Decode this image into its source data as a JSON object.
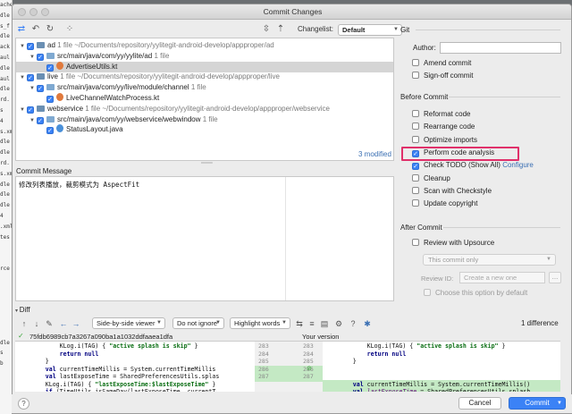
{
  "background_editor_lines": [
    "ache",
    "dle",
    "s_f",
    "dle",
    "ack",
    "aul",
    "dle",
    "aul",
    "dle",
    "rd.",
    "s",
    "4",
    "s.xm",
    "dle",
    "dle",
    "rd.",
    "s.xm",
    "dle",
    "dle",
    "dle",
    "4",
    ".xml",
    "tes",
    "",
    "",
    "rce",
    "",
    "",
    "",
    "",
    "",
    "",
    "dle",
    "s",
    "b",
    ""
  ],
  "window": {
    "title": "Commit Changes"
  },
  "toolbar": {
    "changelist_label": "Changelist:",
    "changelist_value": "Default"
  },
  "tree": {
    "rows": [
      {
        "label": "ad",
        "meta": "1 file  ~/Documents/repository/yylitegit-android-develop/appproper/ad",
        "type": "folder"
      },
      {
        "label": "src/main/java/com/yy/yylite/ad",
        "meta": "1 file",
        "type": "folder"
      },
      {
        "label": "AdvertiseUtils.kt",
        "meta": "",
        "type": "file"
      },
      {
        "label": "live",
        "meta": "1 file  ~/Documents/repository/yylitegit-android-develop/appproper/live",
        "type": "folder"
      },
      {
        "label": "src/main/java/com/yy/live/module/channel",
        "meta": "1 file",
        "type": "folder"
      },
      {
        "label": "LiveChannelWatchProcess.kt",
        "meta": "",
        "type": "file"
      },
      {
        "label": "webservice",
        "meta": "1 file  ~/Documents/repository/yylitegit-android-develop/appproper/webservice",
        "type": "folder"
      },
      {
        "label": "src/main/java/com/yy/webservice/webwindow",
        "meta": "1 file",
        "type": "folder"
      },
      {
        "label": "StatusLayout.java",
        "meta": "",
        "type": "file"
      }
    ],
    "modified_count": "3 modified"
  },
  "commit_message": {
    "label": "Commit Message",
    "text": "修改列表播放，裁剪模式为 AspectFit"
  },
  "git": {
    "section": "Git",
    "author_label": "Author:",
    "author_value": "",
    "amend": "Amend commit",
    "signoff": "Sign-off commit"
  },
  "before_commit": {
    "section": "Before Commit",
    "options": [
      {
        "label": "Reformat code",
        "checked": false
      },
      {
        "label": "Rearrange code",
        "checked": false
      },
      {
        "label": "Optimize imports",
        "checked": false
      },
      {
        "label": "Perform code analysis",
        "checked": true
      },
      {
        "label": "Check TODO (Show All)",
        "checked": true,
        "link": "Configure"
      },
      {
        "label": "Cleanup",
        "checked": false
      },
      {
        "label": "Scan with Checkstyle",
        "checked": false
      },
      {
        "label": "Update copyright",
        "checked": false
      }
    ]
  },
  "after_commit": {
    "section": "After Commit",
    "review_upsource": "Review with Upsource",
    "commit_only": "This commit only",
    "review_id_label": "Review ID:",
    "review_id_placeholder": "Create a new one",
    "dots": "...",
    "choose_default": "Choose this option by default"
  },
  "diff": {
    "header": "Diff",
    "viewer": "Side-by-side viewer",
    "ignore": "Do not ignore",
    "highlight": "Highlight words",
    "differences": "1 difference",
    "left_hash": "75fdb6989cb7a3267a090ba1a1032ddfaaea1dfa",
    "right_title": "Your version",
    "left_lines": [
      {
        "num": "283",
        "parts": [
          [
            "",
            "            KLog.i(TAG) { "
          ],
          [
            "s",
            "\"active splash is skip\""
          ],
          [
            "",
            " }"
          ]
        ]
      },
      {
        "num": "284",
        "parts": [
          [
            "",
            "            "
          ],
          [
            "k",
            "return null"
          ]
        ]
      },
      {
        "num": "285",
        "parts": [
          [
            "",
            "        }"
          ]
        ]
      },
      {
        "num": "286",
        "parts": [
          [
            "",
            "        "
          ],
          [
            "k",
            "val"
          ],
          [
            "",
            " currentTimeMillis = System.currentTimeMillis"
          ]
        ]
      },
      {
        "num": "287",
        "parts": [
          [
            "",
            "        "
          ],
          [
            "k",
            "val"
          ],
          [
            "",
            " lastExposeTime = SharedPreferencesUtils.splas"
          ]
        ]
      },
      {
        "num": "",
        "parts": [
          [
            "",
            "        KLog.i(TAG) { "
          ],
          [
            "s",
            "\"lastExposeTime:$lastExposeTime\""
          ],
          [
            "",
            " }"
          ]
        ]
      },
      {
        "num": "",
        "parts": [
          [
            "",
            "        "
          ],
          [
            "k",
            "if"
          ],
          [
            "",
            " (TimeUtils.isSameDay(lastExposeTime, currentT"
          ]
        ]
      }
    ],
    "right_lines": [
      {
        "num": "283",
        "parts": [
          [
            "",
            "            KLog.i(TAG) { "
          ],
          [
            "s",
            "\"active splash is skip\""
          ],
          [
            "",
            " }"
          ]
        ]
      },
      {
        "num": "284",
        "parts": [
          [
            "",
            "            "
          ],
          [
            "k",
            "return null"
          ]
        ]
      },
      {
        "num": "285",
        "parts": [
          [
            "",
            "        }"
          ]
        ]
      },
      {
        "num": "286",
        "parts": [
          [
            "",
            ""
          ]
        ]
      },
      {
        "num": "287",
        "parts": [
          [
            "",
            ""
          ]
        ]
      },
      {
        "num": "",
        "parts": [
          [
            "",
            "        "
          ],
          [
            "k",
            "val"
          ],
          [
            "",
            " currentTimeMillis = System.currentTimeMillis()"
          ]
        ]
      },
      {
        "num": "",
        "parts": [
          [
            "",
            "        "
          ],
          [
            "k",
            "val"
          ],
          [
            "",
            " "
          ],
          [
            "f",
            "lastExposeTime"
          ],
          [
            "",
            " = SharedPreferencesUtils.splash"
          ]
        ]
      }
    ]
  },
  "footer": {
    "help": "?",
    "cancel": "Cancel",
    "commit": "Commit"
  },
  "colors": {
    "accent": "#3b82f6",
    "highlight_box": "#e0306a",
    "diff_added": "#c4e9c4",
    "link": "#3a6fb3"
  }
}
